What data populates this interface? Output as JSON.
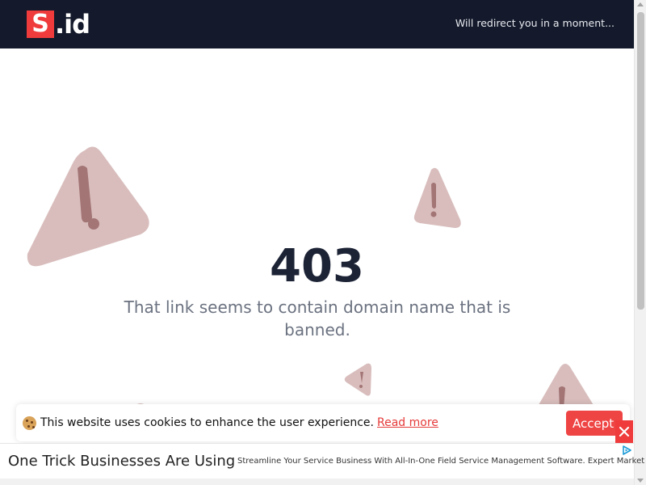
{
  "header": {
    "logo_letter": "S",
    "logo_suffix": ".id",
    "redirect_text": "Will redirect you in a moment..."
  },
  "error": {
    "code": "403",
    "message": "That link seems to contain domain name that is banned."
  },
  "cookie": {
    "text": "This website uses cookies to enhance the user experience.",
    "link_label": "Read more",
    "accept_label": "Accept"
  },
  "ad": {
    "title": "One Trick Businesses Are Using",
    "description": "Streamline Your Service Business With All-In-One Field Service Management Software. Expert Market"
  },
  "colors": {
    "header_bg": "#141a2b",
    "brand_red": "#ef3b3b",
    "warning_fill": "#d9bdbd",
    "warning_mark": "#a37575",
    "code_text": "#1c2335",
    "message_text": "#6b7280"
  },
  "icons": [
    "warning-icon",
    "cookie-icon",
    "close-icon",
    "adchoices-icon"
  ]
}
